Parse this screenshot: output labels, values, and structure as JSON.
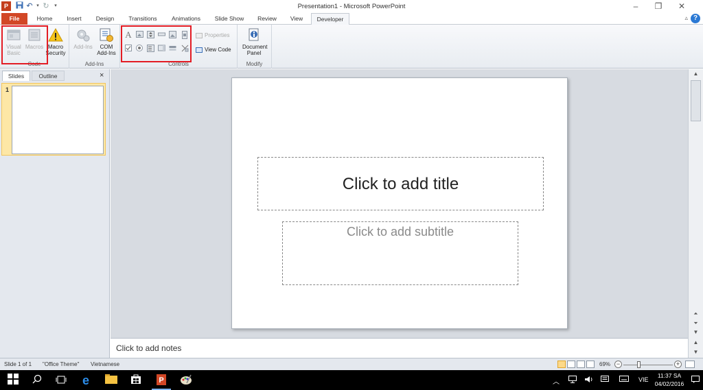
{
  "window": {
    "title": "Presentation1 - Microsoft PowerPoint",
    "app_icon": "P",
    "quick_access": [
      "save-icon",
      "undo-icon",
      "redo-icon",
      "customize-icon"
    ],
    "controls": [
      "minimize-icon",
      "restore-icon",
      "close-icon"
    ]
  },
  "tabs": {
    "file": "File",
    "items": [
      "Home",
      "Insert",
      "Design",
      "Transitions",
      "Animations",
      "Slide Show",
      "Review",
      "View",
      "Developer"
    ],
    "active": "Developer",
    "help": "?"
  },
  "ribbon": {
    "code": {
      "label": "Code",
      "visual_basic": "Visual Basic",
      "macros": "Macros",
      "macro_security": "Macro Security"
    },
    "addins": {
      "label": "Add-Ins",
      "addins": "Add-Ins",
      "com_addins": "COM Add-Ins"
    },
    "controls": {
      "label": "Controls",
      "properties": "Properties",
      "view_code": "View Code",
      "label_icon": "A"
    },
    "modify": {
      "label": "Modify",
      "document_panel": "Document Panel"
    }
  },
  "left_panel": {
    "tab_slides": "Slides",
    "tab_outline": "Outline",
    "close": "×",
    "slide_number": "1"
  },
  "slide": {
    "title_placeholder": "Click to add title",
    "subtitle_placeholder": "Click to add subtitle"
  },
  "notes": {
    "placeholder": "Click to add notes"
  },
  "status": {
    "slide_count": "Slide 1 of 1",
    "theme": "\"Office Theme\"",
    "language": "Vietnamese",
    "zoom": "69%",
    "zoom_level": 0.69
  },
  "taskbar": {
    "language": "VIE",
    "time": "11:37 SA",
    "date": "04/02/2016"
  },
  "colors": {
    "file_tab": "#d24726",
    "highlight_box": "#e31b23",
    "thumbnail_selected": "#fde7a6"
  }
}
